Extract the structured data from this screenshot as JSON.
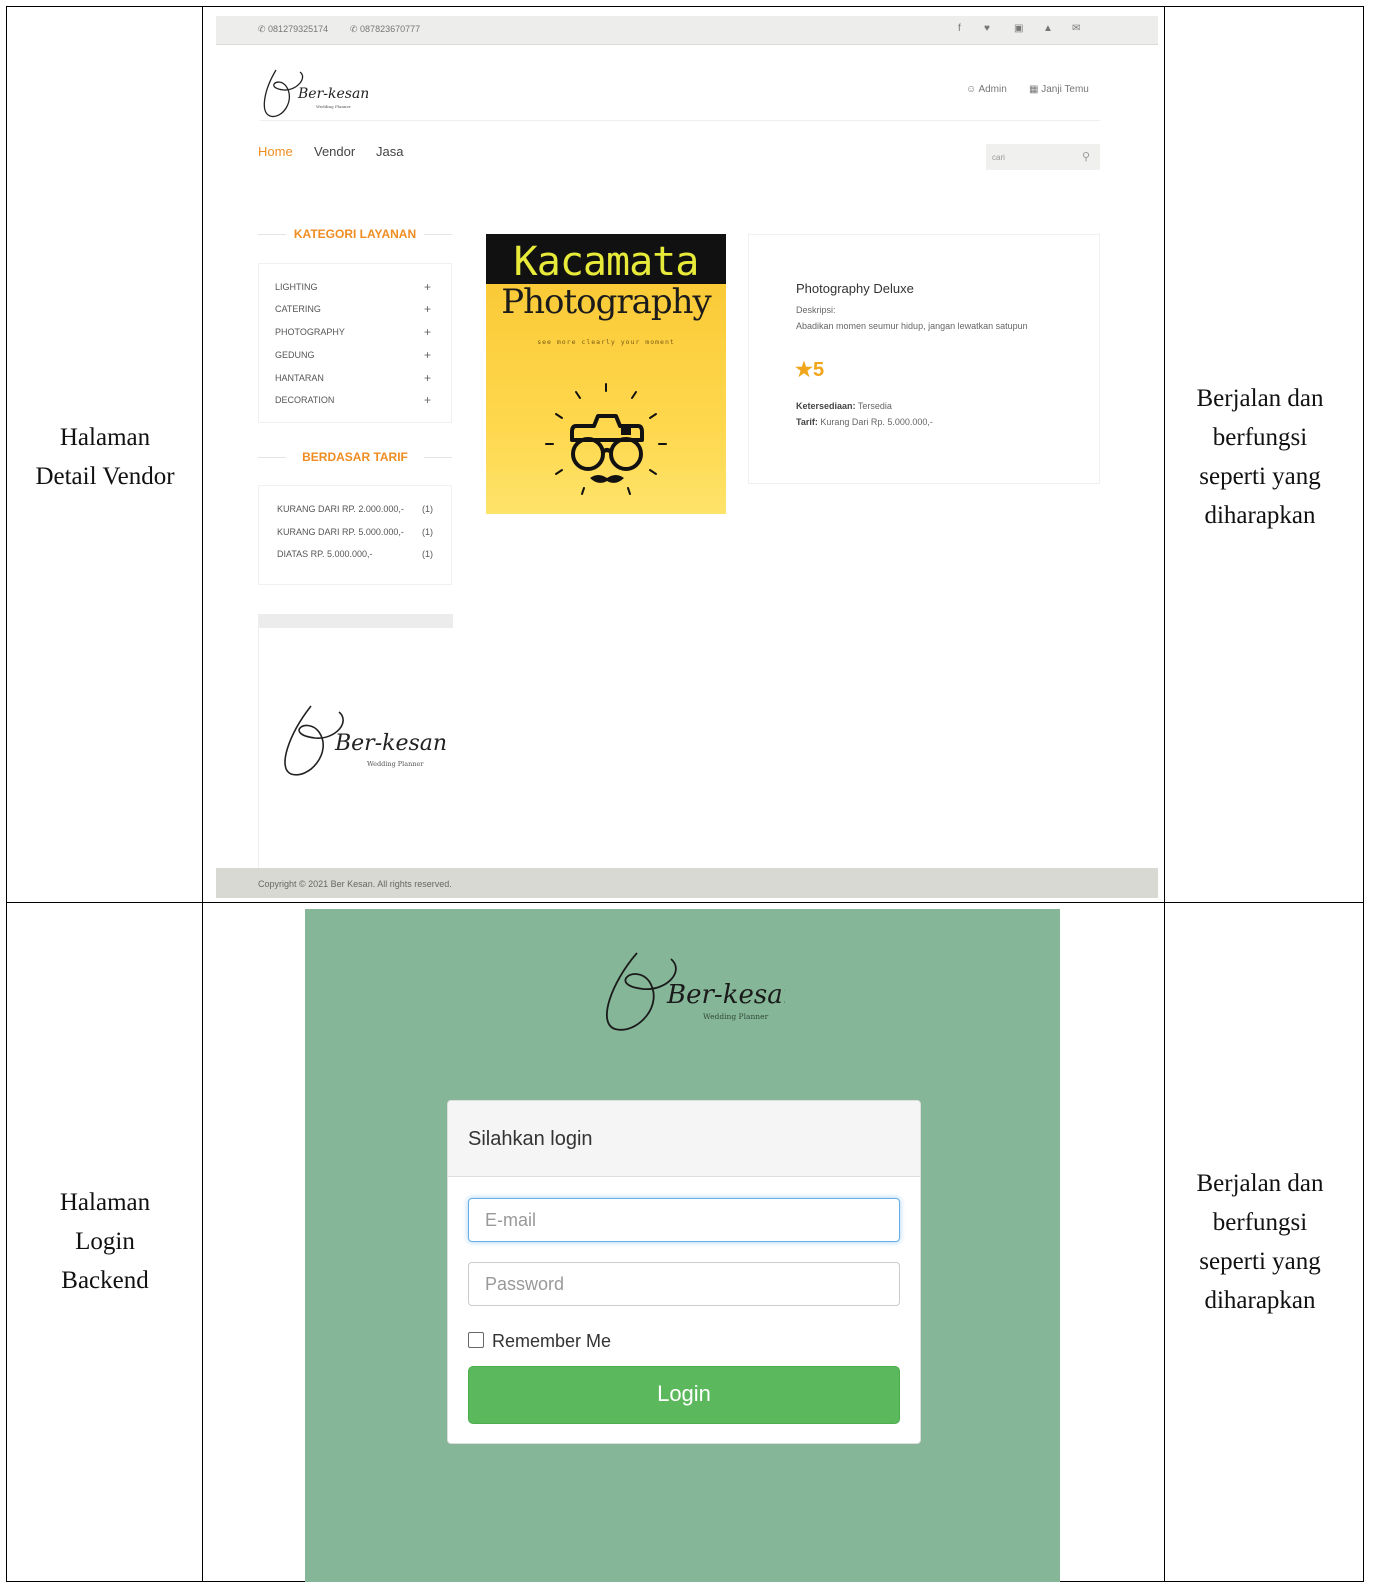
{
  "table": {
    "rows": [
      {
        "label_lines": [
          "Halaman",
          "Detail Vendor"
        ],
        "result_lines": [
          "Berjalan dan",
          "berfungsi",
          "seperti yang",
          "diharapkan"
        ]
      },
      {
        "label_lines": [
          "Halaman",
          "Login",
          "Backend"
        ],
        "result_lines": [
          "Berjalan dan",
          "berfungsi",
          "seperti yang",
          "diharapkan"
        ]
      }
    ]
  },
  "vendor_page": {
    "topbar": {
      "phones": [
        "081279325174",
        "087823670777"
      ],
      "social_icons": [
        "facebook-icon",
        "twitter-icon",
        "instagram-icon",
        "youtube-icon",
        "mail-icon"
      ],
      "social_glyphs": [
        "f",
        "♥",
        "▣",
        "▲",
        "✉"
      ]
    },
    "brand": {
      "logo_text": "Ber-kesan",
      "logo_sub": "Wedding Planner"
    },
    "header_links": {
      "admin": "Admin",
      "appointment": "Janji Temu"
    },
    "nav": {
      "items": [
        "Home",
        "Vendor",
        "Jasa"
      ],
      "active": "Home"
    },
    "search": {
      "placeholder": "cari"
    },
    "sidebar": {
      "category_title": "KATEGORI LAYANAN",
      "categories": [
        "LIGHTING",
        "CATERING",
        "PHOTOGRAPHY",
        "GEDUNG",
        "HANTARAN",
        "DECORATION"
      ],
      "tarif_title": "BERDASAR TARIF",
      "tarif": [
        {
          "label": "KURANG DARI RP. 2.000.000,-",
          "count": "(1)"
        },
        {
          "label": "KURANG DARI RP. 5.000.000,-",
          "count": "(1)"
        },
        {
          "label": "DIATAS RP. 5.000.000,-",
          "count": "(1)"
        }
      ]
    },
    "vendor_image": {
      "line1": "Kacamata",
      "line2": "Photography",
      "tagline": "see more clearly your moment"
    },
    "product": {
      "title": "Photography Deluxe",
      "desc_label": "Deskripsi:",
      "desc": "Abadikan momen seumur hidup, jangan lewatkan satupun",
      "rating": "5",
      "availability_label": "Ketersediaan:",
      "availability": "Tersedia",
      "tarif_label": "Tarif:",
      "tarif": "Kurang Dari Rp. 5.000.000,-"
    },
    "footer": {
      "copyright": "Copyright © 2021 Ber Kesan. All rights reserved."
    }
  },
  "login_page": {
    "brand": {
      "logo_text": "Ber-kesan",
      "logo_sub": "Wedding Planner"
    },
    "panel_title": "Silahkan login",
    "email": {
      "placeholder": "E-mail",
      "value": ""
    },
    "password": {
      "placeholder": "Password",
      "value": ""
    },
    "remember_label": "Remember Me",
    "login_button": "Login",
    "colors": {
      "background": "#86b698",
      "button": "#5cb85c",
      "accent": "#f08d22"
    }
  }
}
